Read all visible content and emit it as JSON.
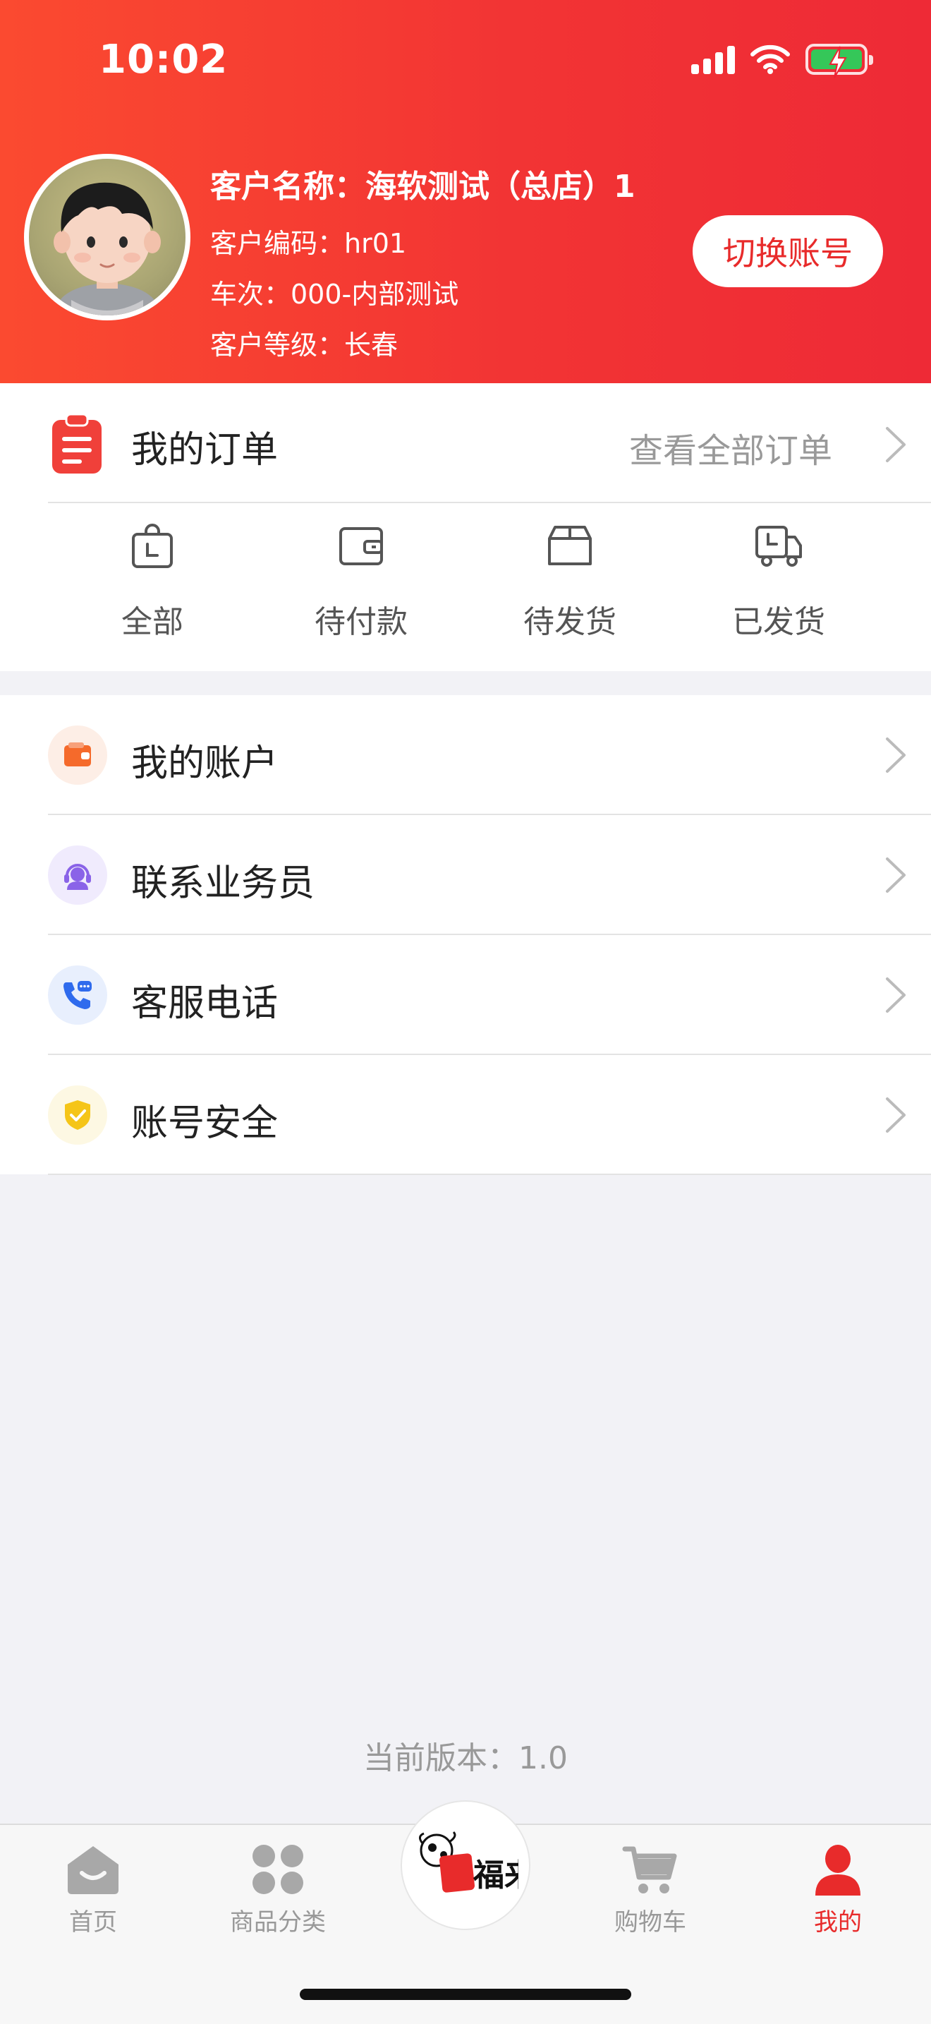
{
  "status_bar": {
    "time": "10:02"
  },
  "profile": {
    "name": "客户名称：海软测试（总店）1",
    "code": "客户编码：hr01",
    "route": "车次：000-内部测试",
    "level": "客户等级：长春",
    "switch_account_label": "切换账号"
  },
  "orders": {
    "title": "我的订单",
    "view_all_label": "查看全部订单",
    "statuses": [
      {
        "label": "全部",
        "icon": "bag-clock-icon"
      },
      {
        "label": "待付款",
        "icon": "wallet-icon"
      },
      {
        "label": "待发货",
        "icon": "box-icon"
      },
      {
        "label": "已发货",
        "icon": "truck-icon"
      }
    ]
  },
  "menu": [
    {
      "label": "我的账户",
      "icon": "wallet-icon",
      "color": "#f56a2b"
    },
    {
      "label": "联系业务员",
      "icon": "headset-icon",
      "color": "#8a63e8"
    },
    {
      "label": "客服电话",
      "icon": "phone-icon",
      "color": "#2f6bed"
    },
    {
      "label": "账号安全",
      "icon": "shield-check-icon",
      "color": "#f5c518"
    }
  ],
  "version_text": "当前版本：1.0",
  "tabbar": {
    "tabs": [
      {
        "label": "首页",
        "icon": "home-icon",
        "active": false
      },
      {
        "label": "商品分类",
        "icon": "category-icon",
        "active": false
      },
      {
        "label": "",
        "icon": "brand-logo",
        "active": false
      },
      {
        "label": "购物车",
        "icon": "cart-icon",
        "active": false
      },
      {
        "label": "我的",
        "icon": "user-icon",
        "active": true
      }
    ],
    "logo_text": "福来"
  },
  "colors": {
    "accent": "#e82b2b",
    "header_start": "#fb4a30",
    "header_end": "#ee2a36"
  }
}
